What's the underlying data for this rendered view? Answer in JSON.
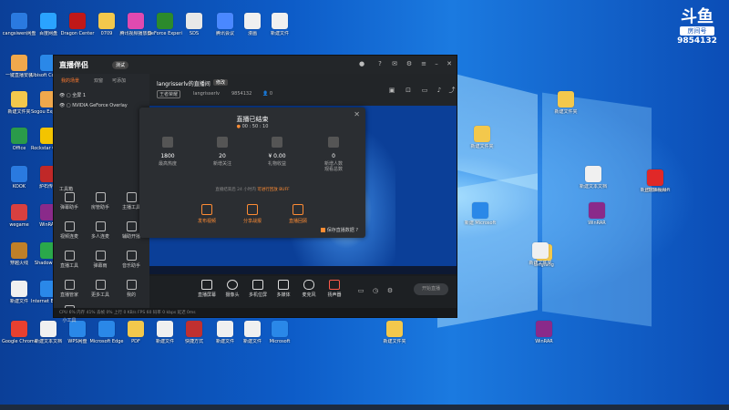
{
  "desktop": {
    "icons": [
      {
        "label": "cangsiwen网盘",
        "color": "#2a7ae0"
      },
      {
        "label": "百度网盘",
        "color": "#2aa3ff"
      },
      {
        "label": "Dragon Center",
        "color": "#c01818"
      },
      {
        "label": "0709",
        "color": "#f3c84c"
      },
      {
        "label": "腾讯视频播放器",
        "color": "#e04ab0"
      },
      {
        "label": "GeForce Experience",
        "color": "#2c8a2c"
      },
      {
        "label": "SDS",
        "color": "#e8e8e8"
      },
      {
        "label": "腾讯会议",
        "color": "#4a88ff"
      },
      {
        "label": "漫画",
        "color": "#f0f0f0"
      },
      {
        "label": "新建文件",
        "color": "#f0f0f0"
      },
      {
        "label": "一键直播安装",
        "color": "#f0a84c"
      },
      {
        "label": "Ubisoft Connect",
        "color": "#2a88e8"
      },
      {
        "label": "新建文件夹",
        "color": "#f3c84c"
      },
      {
        "label": "Sogou Explorer",
        "color": "#f0a84c"
      },
      {
        "label": "Office",
        "color": "#2a9a4a"
      },
      {
        "label": "Rockstar Games",
        "color": "#f3c400"
      },
      {
        "label": "KOOK",
        "color": "#2a7ae0"
      },
      {
        "label": "炉石传说",
        "color": "#c02828"
      },
      {
        "label": "wegame",
        "color": "#d84040"
      },
      {
        "label": "WinRAR",
        "color": "#8a2a8a"
      },
      {
        "label": "穿越火线",
        "color": "#c08028"
      },
      {
        "label": "ShadowPlay",
        "color": "#2aa84a"
      },
      {
        "label": "新建文件",
        "color": "#f0f0f0"
      },
      {
        "label": "Internet Explorer",
        "color": "#2a88e8"
      },
      {
        "label": "快捷方式",
        "color": "#c03030"
      },
      {
        "label": "Google Chrome",
        "color": "#e84030"
      },
      {
        "label": "新建文本文档",
        "color": "#f0f0f0"
      },
      {
        "label": "WPS网盘",
        "color": "#2a88e8"
      },
      {
        "label": "Microsoft Edge",
        "color": "#2a88e8"
      },
      {
        "label": "PDF",
        "color": "#f3c84c"
      },
      {
        "label": "新建文件",
        "color": "#f0f0f0"
      },
      {
        "label": "新建文件",
        "color": "#f0f0f0"
      },
      {
        "label": "新建文件",
        "color": "#f0f0f0"
      },
      {
        "label": "Microsoft",
        "color": "#2a88e8"
      },
      {
        "label": "新建文件夹",
        "color": "#f3c84c"
      },
      {
        "label": "WinRAR",
        "color": "#8a2a8a"
      },
      {
        "label": "Lingfang",
        "color": "#f3c84c"
      },
      {
        "label": "新建文件夹",
        "color": "#f3c84c"
      },
      {
        "label": "新建文件夹",
        "color": "#f3c84c"
      },
      {
        "label": "新建 Microsoft",
        "color": "#2a88e8"
      },
      {
        "label": "WinRAR",
        "color": "#8a2a8a"
      },
      {
        "label": "新建文本文档",
        "color": "#f0f0f0"
      },
      {
        "label": "新建文件夹",
        "color": "#f0f0f0"
      },
      {
        "label": "新建Microsoft",
        "color": "#2a88e8"
      },
      {
        "label": "上班族视频",
        "color": "#e02828"
      }
    ]
  },
  "logo": {
    "mark": "斗鱼",
    "room": "房间号",
    "number": "9854132"
  },
  "app": {
    "brand": "直播伴侣",
    "version": "测试",
    "tabs": [
      "我的场景",
      "双窗",
      "可添加"
    ],
    "scenes": [
      "全屏 1",
      "NVIDIA GeForce Overlay"
    ],
    "tools_title": "工具箱",
    "tools": [
      "弹幕助手",
      "房管助手",
      "主播工具",
      "视频连麦",
      "多人连麦",
      "辅助开播",
      "直播工具",
      "弹幕雨",
      "音乐助手",
      "直播管家",
      "更多工具",
      "我的",
      "小工具"
    ],
    "room": {
      "title": "langrisserlv的直播间",
      "tag": "修改",
      "category": "王者荣耀",
      "user": "langrisserlv",
      "room_id": "9854132",
      "viewers": "0"
    },
    "controls": [
      "直播屏幕",
      "摄像头",
      "多机位屏",
      "多媒体",
      "麦克风",
      "扬声器"
    ],
    "go_live": "开始直播",
    "status": "CPU 6%   内存 41%   丢帧 0%   上行 0 KB/s   FPS 60   码率 0 kbps   延迟 0ms"
  },
  "modal": {
    "title": "直播已结束",
    "duration": "00 : 50 : 10",
    "stats": [
      {
        "value": "1800",
        "label": "最高热度"
      },
      {
        "value": "20",
        "label": "新增关注"
      },
      {
        "value": "¥ 0.00",
        "label": "礼物收益"
      },
      {
        "value": "0",
        "label": "新增人数\n观看总数"
      }
    ],
    "note_prefix": "直播结束后 24 小时内 ",
    "note_link": "可进行回放 BUFF",
    "actions": [
      "发布视频",
      "分享战报",
      "直播回顾"
    ],
    "checkbox_label": "保存直播数据"
  }
}
